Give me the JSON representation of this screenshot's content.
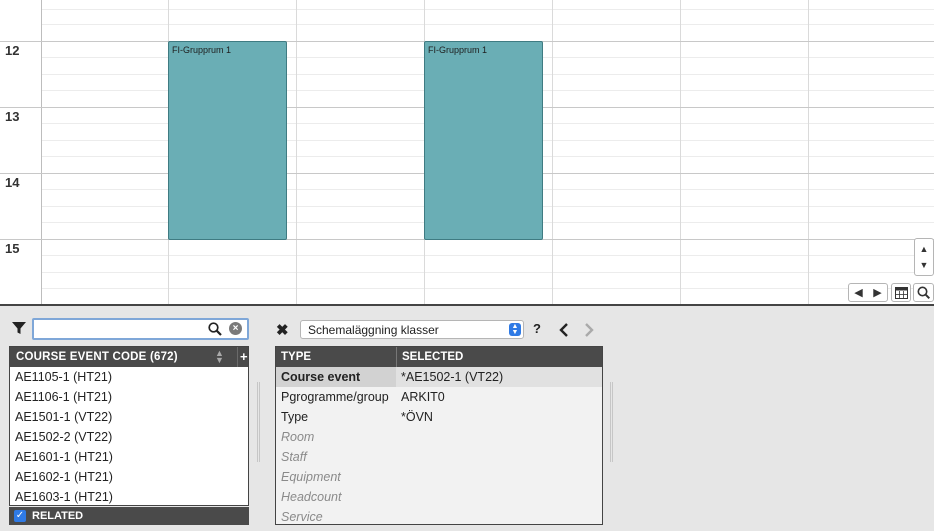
{
  "calendar": {
    "hours": [
      "12",
      "13",
      "14",
      "15"
    ],
    "events": [
      {
        "label": "FI-Grupprum 1"
      },
      {
        "label": "FI-Grupprum 1"
      }
    ]
  },
  "filter": {
    "search_value": "",
    "search_placeholder": ""
  },
  "course_list": {
    "header": "COURSE EVENT CODE (672)",
    "add_label": "+",
    "items": [
      "AE1105-1 (HT21)",
      "AE1106-1 (HT21)",
      "AE1501-1 (VT22)",
      "AE1502-2 (VT22)",
      "AE1601-1 (HT21)",
      "AE1602-1 (HT21)",
      "AE1603-1 (HT21)"
    ],
    "related_label": "RELATED",
    "related_checked": true
  },
  "toolbar": {
    "view_select_value": "Schemaläggning klasser",
    "help_label": "?"
  },
  "details": {
    "col_type": "TYPE",
    "col_selected": "SELECTED",
    "rows": [
      {
        "type": "Course event",
        "value": "*AE1502-1 (VT22)"
      },
      {
        "type": "Pgrogramme/group",
        "value": "ARKIT0"
      },
      {
        "type": "Type",
        "value": "*ÖVN"
      },
      {
        "type": "Room",
        "value": ""
      },
      {
        "type": "Staff",
        "value": ""
      },
      {
        "type": "Equipment",
        "value": ""
      },
      {
        "type": "Headcount",
        "value": ""
      },
      {
        "type": "Service",
        "value": ""
      }
    ]
  },
  "colors": {
    "event_fill": "#6aaeb5",
    "header_bg": "#4a4a4a",
    "accent": "#2f7ae5"
  }
}
